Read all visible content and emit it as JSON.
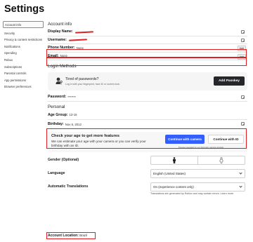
{
  "page": {
    "title": "Settings"
  },
  "sidebar": {
    "items": [
      {
        "label": "Account info",
        "active": true
      },
      {
        "label": "Security"
      },
      {
        "label": "Privacy & content restrictions"
      },
      {
        "label": "Notifications"
      },
      {
        "label": "Spending"
      },
      {
        "label": "Robux"
      },
      {
        "label": "Subscriptions"
      },
      {
        "label": "Parental controls"
      },
      {
        "label": "App permissions"
      },
      {
        "label": "Browser preferences"
      }
    ]
  },
  "account": {
    "heading": "Account info",
    "display_name_label": "Display Name:",
    "username_label": "Username:",
    "phone_label": "Phone Number:",
    "phone_value": "None",
    "phone_add": "Add",
    "email_label": "Email:",
    "email_value": "None",
    "email_add": "Add"
  },
  "login": {
    "heading": "Login Methods",
    "passkey_title": "Tired of passwords?",
    "passkey_sub": "Log in with your fingerprint, face ID or screen lock.",
    "passkey_button": "Add Passkey",
    "password_label": "Password:",
    "password_value": "*******"
  },
  "personal": {
    "heading": "Personal",
    "age_label": "Age Group:",
    "age_value": "13-15",
    "birthday_label": "Birthday:",
    "birthday_value": "Nov 6, 2012"
  },
  "verify": {
    "title": "Check your age to get more features",
    "subtitle": "We can estimate your age with your camera or you can verify your birthday with an ID.",
    "camera_button": "Continue with camera",
    "id_button": "Continue with ID",
    "note": "Process operated by our third party service provider"
  },
  "gender": {
    "label": "Gender (Optional)",
    "option_male_icon": "male-icon",
    "option_female_icon": "female-icon"
  },
  "language": {
    "label": "Language",
    "value": "English (United States)"
  },
  "translations": {
    "label": "Automatic Translations",
    "value": "On (experience content only)",
    "note": "Translations are generated by Roblox and may contain errors. Learn more."
  },
  "location": {
    "label": "Account Location:",
    "value": "Brazil"
  },
  "colors": {
    "highlight": "#e02020",
    "primary_button": "#335fff",
    "dark_button": "#26272b"
  }
}
